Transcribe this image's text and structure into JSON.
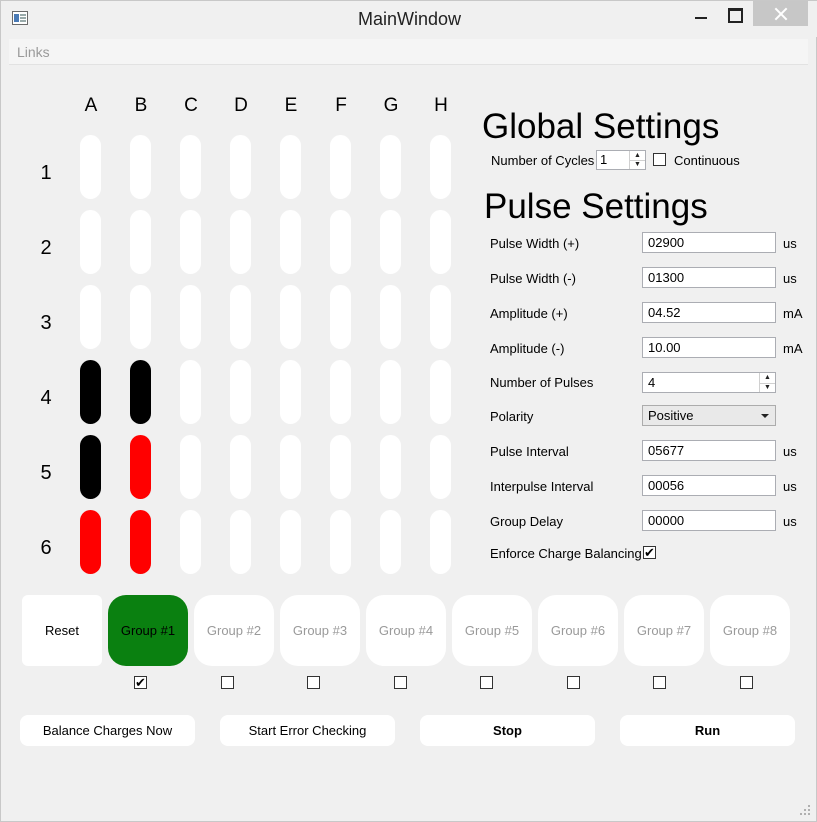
{
  "window": {
    "title": "MainWindow"
  },
  "menu": {
    "links": "Links"
  },
  "grid": {
    "columns": [
      "A",
      "B",
      "C",
      "D",
      "E",
      "F",
      "G",
      "H"
    ],
    "rows": [
      "1",
      "2",
      "3",
      "4",
      "5",
      "6"
    ],
    "colors": {
      "empty": "#ffffff",
      "black": "#000000",
      "red": "#ff0000"
    },
    "wells": [
      [
        "empty",
        "empty",
        "empty",
        "empty",
        "empty",
        "empty",
        "empty",
        "empty"
      ],
      [
        "empty",
        "empty",
        "empty",
        "empty",
        "empty",
        "empty",
        "empty",
        "empty"
      ],
      [
        "empty",
        "empty",
        "empty",
        "empty",
        "empty",
        "empty",
        "empty",
        "empty"
      ],
      [
        "black",
        "black",
        "empty",
        "empty",
        "empty",
        "empty",
        "empty",
        "empty"
      ],
      [
        "black",
        "red",
        "empty",
        "empty",
        "empty",
        "empty",
        "empty",
        "empty"
      ],
      [
        "red",
        "red",
        "empty",
        "empty",
        "empty",
        "empty",
        "empty",
        "empty"
      ]
    ]
  },
  "global_settings": {
    "heading": "Global Settings",
    "cycles_label": "Number of Cycles",
    "cycles_value": "1",
    "continuous_label": "Continuous",
    "continuous_checked": false
  },
  "pulse_settings": {
    "heading": "Pulse Settings",
    "pulse_width_pos": {
      "label": "Pulse Width (+)",
      "value": "02900",
      "unit": "us"
    },
    "pulse_width_neg": {
      "label": "Pulse Width (-)",
      "value": "01300",
      "unit": "us"
    },
    "amplitude_pos": {
      "label": "Amplitude (+)",
      "value": "04.52",
      "unit": "mA"
    },
    "amplitude_neg": {
      "label": "Amplitude (-)",
      "value": "10.00",
      "unit": "mA"
    },
    "num_pulses": {
      "label": "Number of Pulses",
      "value": "4"
    },
    "polarity": {
      "label": "Polarity",
      "value": "Positive"
    },
    "pulse_interval": {
      "label": "Pulse Interval",
      "value": "05677",
      "unit": "us"
    },
    "interpulse_interval": {
      "label": "Interpulse Interval",
      "value": "00056",
      "unit": "us"
    },
    "group_delay": {
      "label": "Group Delay",
      "value": "00000",
      "unit": "us"
    },
    "charge_balancing": {
      "label": "Enforce Charge Balancing",
      "checked": true
    }
  },
  "groups": {
    "reset_label": "Reset",
    "active_color": "#0a8010",
    "items": [
      {
        "label": "Group #1",
        "active": true,
        "checked": true
      },
      {
        "label": "Group #2",
        "active": false,
        "checked": false
      },
      {
        "label": "Group #3",
        "active": false,
        "checked": false
      },
      {
        "label": "Group #4",
        "active": false,
        "checked": false
      },
      {
        "label": "Group #5",
        "active": false,
        "checked": false
      },
      {
        "label": "Group #6",
        "active": false,
        "checked": false
      },
      {
        "label": "Group #7",
        "active": false,
        "checked": false
      },
      {
        "label": "Group #8",
        "active": false,
        "checked": false
      }
    ]
  },
  "actions": {
    "balance": "Balance Charges Now",
    "error_check": "Start Error Checking",
    "stop": "Stop",
    "run": "Run"
  },
  "icons": {
    "app": "app-window-icon",
    "minimize": "minimize-icon",
    "maximize": "maximize-icon",
    "close": "close-icon",
    "check": "✔",
    "dropdown": "chevron-down-icon",
    "spin_up": "▲",
    "spin_down": "▼",
    "resize": "resize-grip-icon"
  }
}
